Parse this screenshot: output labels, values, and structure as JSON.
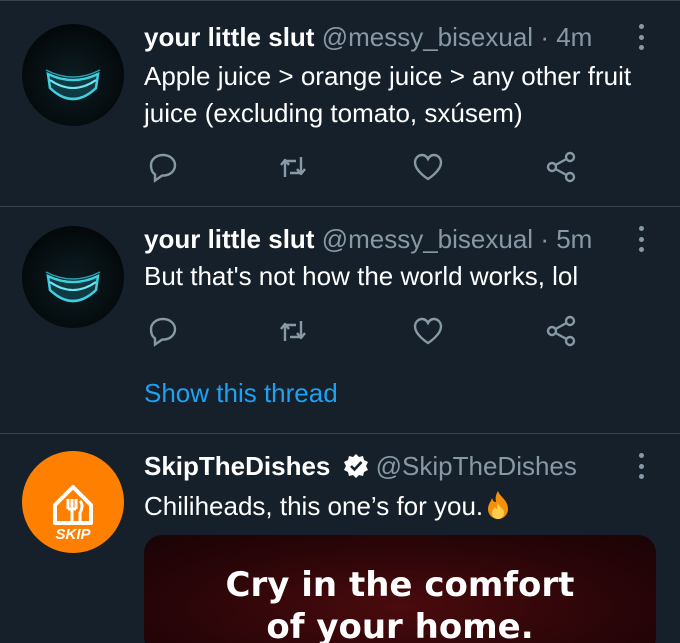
{
  "tweets": [
    {
      "display_name": "your little slut",
      "handle": "@messy_bisexual",
      "separator": "·",
      "time": "4m",
      "text": "Apple juice > orange juice > any other fruit juice (excluding tomato, sxúsem)"
    },
    {
      "display_name": "your little slut",
      "handle": "@messy_bisexual",
      "separator": "·",
      "time": "5m",
      "text": "But that's not how the world works, lol",
      "thread_link": "Show this thread"
    },
    {
      "display_name": "SkipTheDishes",
      "handle": "@SkipTheDishes",
      "verified": true,
      "text": "Chiliheads, this one’s for you.",
      "emoji": "fire-icon",
      "avatar_label": "SKIP",
      "ad_text_line1": "Cry in the comfort",
      "ad_text_line2": "of your home."
    }
  ],
  "colors": {
    "background": "#15202b",
    "divider": "#38444d",
    "secondary_text": "#8899a6",
    "link": "#1da1f2",
    "skip_orange": "#ff8000",
    "avatar_glow": "#3fd0e0"
  },
  "icons": [
    "reply-icon",
    "retweet-icon",
    "like-icon",
    "share-icon",
    "more-icon",
    "verified-icon"
  ]
}
